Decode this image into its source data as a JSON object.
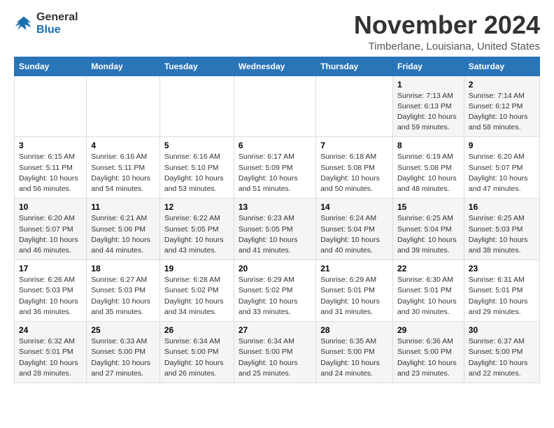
{
  "logo": {
    "line1": "General",
    "line2": "Blue"
  },
  "title": "November 2024",
  "location": "Timberlane, Louisiana, United States",
  "days_of_week": [
    "Sunday",
    "Monday",
    "Tuesday",
    "Wednesday",
    "Thursday",
    "Friday",
    "Saturday"
  ],
  "weeks": [
    [
      {
        "day": "",
        "info": ""
      },
      {
        "day": "",
        "info": ""
      },
      {
        "day": "",
        "info": ""
      },
      {
        "day": "",
        "info": ""
      },
      {
        "day": "",
        "info": ""
      },
      {
        "day": "1",
        "info": "Sunrise: 7:13 AM\nSunset: 6:13 PM\nDaylight: 10 hours and 59 minutes."
      },
      {
        "day": "2",
        "info": "Sunrise: 7:14 AM\nSunset: 6:12 PM\nDaylight: 10 hours and 58 minutes."
      }
    ],
    [
      {
        "day": "3",
        "info": "Sunrise: 6:15 AM\nSunset: 5:11 PM\nDaylight: 10 hours and 56 minutes."
      },
      {
        "day": "4",
        "info": "Sunrise: 6:16 AM\nSunset: 5:11 PM\nDaylight: 10 hours and 54 minutes."
      },
      {
        "day": "5",
        "info": "Sunrise: 6:16 AM\nSunset: 5:10 PM\nDaylight: 10 hours and 53 minutes."
      },
      {
        "day": "6",
        "info": "Sunrise: 6:17 AM\nSunset: 5:09 PM\nDaylight: 10 hours and 51 minutes."
      },
      {
        "day": "7",
        "info": "Sunrise: 6:18 AM\nSunset: 5:08 PM\nDaylight: 10 hours and 50 minutes."
      },
      {
        "day": "8",
        "info": "Sunrise: 6:19 AM\nSunset: 5:08 PM\nDaylight: 10 hours and 48 minutes."
      },
      {
        "day": "9",
        "info": "Sunrise: 6:20 AM\nSunset: 5:07 PM\nDaylight: 10 hours and 47 minutes."
      }
    ],
    [
      {
        "day": "10",
        "info": "Sunrise: 6:20 AM\nSunset: 5:07 PM\nDaylight: 10 hours and 46 minutes."
      },
      {
        "day": "11",
        "info": "Sunrise: 6:21 AM\nSunset: 5:06 PM\nDaylight: 10 hours and 44 minutes."
      },
      {
        "day": "12",
        "info": "Sunrise: 6:22 AM\nSunset: 5:05 PM\nDaylight: 10 hours and 43 minutes."
      },
      {
        "day": "13",
        "info": "Sunrise: 6:23 AM\nSunset: 5:05 PM\nDaylight: 10 hours and 41 minutes."
      },
      {
        "day": "14",
        "info": "Sunrise: 6:24 AM\nSunset: 5:04 PM\nDaylight: 10 hours and 40 minutes."
      },
      {
        "day": "15",
        "info": "Sunrise: 6:25 AM\nSunset: 5:04 PM\nDaylight: 10 hours and 39 minutes."
      },
      {
        "day": "16",
        "info": "Sunrise: 6:25 AM\nSunset: 5:03 PM\nDaylight: 10 hours and 38 minutes."
      }
    ],
    [
      {
        "day": "17",
        "info": "Sunrise: 6:26 AM\nSunset: 5:03 PM\nDaylight: 10 hours and 36 minutes."
      },
      {
        "day": "18",
        "info": "Sunrise: 6:27 AM\nSunset: 5:03 PM\nDaylight: 10 hours and 35 minutes."
      },
      {
        "day": "19",
        "info": "Sunrise: 6:28 AM\nSunset: 5:02 PM\nDaylight: 10 hours and 34 minutes."
      },
      {
        "day": "20",
        "info": "Sunrise: 6:29 AM\nSunset: 5:02 PM\nDaylight: 10 hours and 33 minutes."
      },
      {
        "day": "21",
        "info": "Sunrise: 6:29 AM\nSunset: 5:01 PM\nDaylight: 10 hours and 31 minutes."
      },
      {
        "day": "22",
        "info": "Sunrise: 6:30 AM\nSunset: 5:01 PM\nDaylight: 10 hours and 30 minutes."
      },
      {
        "day": "23",
        "info": "Sunrise: 6:31 AM\nSunset: 5:01 PM\nDaylight: 10 hours and 29 minutes."
      }
    ],
    [
      {
        "day": "24",
        "info": "Sunrise: 6:32 AM\nSunset: 5:01 PM\nDaylight: 10 hours and 28 minutes."
      },
      {
        "day": "25",
        "info": "Sunrise: 6:33 AM\nSunset: 5:00 PM\nDaylight: 10 hours and 27 minutes."
      },
      {
        "day": "26",
        "info": "Sunrise: 6:34 AM\nSunset: 5:00 PM\nDaylight: 10 hours and 26 minutes."
      },
      {
        "day": "27",
        "info": "Sunrise: 6:34 AM\nSunset: 5:00 PM\nDaylight: 10 hours and 25 minutes."
      },
      {
        "day": "28",
        "info": "Sunrise: 6:35 AM\nSunset: 5:00 PM\nDaylight: 10 hours and 24 minutes."
      },
      {
        "day": "29",
        "info": "Sunrise: 6:36 AM\nSunset: 5:00 PM\nDaylight: 10 hours and 23 minutes."
      },
      {
        "day": "30",
        "info": "Sunrise: 6:37 AM\nSunset: 5:00 PM\nDaylight: 10 hours and 22 minutes."
      }
    ]
  ]
}
